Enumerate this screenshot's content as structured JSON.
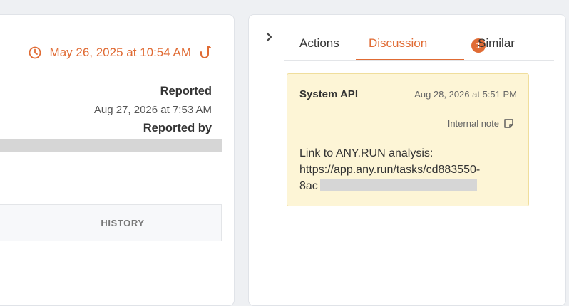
{
  "left": {
    "timestamp": "May 26, 2025 at 10:54 AM",
    "reported_label": "Reported",
    "reported_value": "Aug 27, 2026 at 7:53 AM",
    "reported_by_label": "Reported by",
    "history_tab": "HISTORY",
    "icons": {
      "clock": "clock-icon",
      "hook": "hook-icon"
    }
  },
  "right": {
    "tabs": [
      {
        "label": "Actions"
      },
      {
        "label": "Discussion",
        "badge": "1",
        "active": true
      },
      {
        "label": "Similar"
      }
    ],
    "note": {
      "author": "System API",
      "date": "Aug 28, 2026 at 5:51 PM",
      "flag": "Internal note",
      "line1": "Link to ANY.RUN analysis:",
      "line2": "https://app.any.run/tasks/cd883550-",
      "line3": "8ac"
    }
  },
  "colors": {
    "accent": "#e06b34",
    "note_bg": "#fdf5d6",
    "note_border": "#f0de9c"
  }
}
